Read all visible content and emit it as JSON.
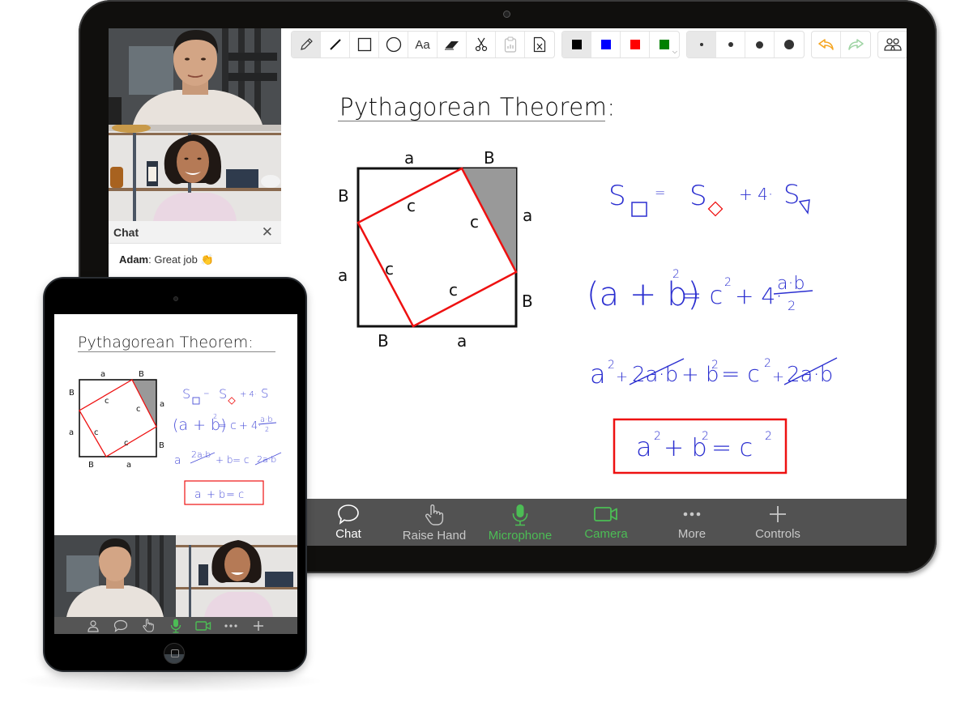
{
  "app": {
    "accent_green": "#4cbd55",
    "bar_color": "#525252"
  },
  "participants": [
    {
      "name": "Man in white t-shirt",
      "role": "video-feed"
    },
    {
      "name": "Woman in plaid shirt",
      "role": "video-feed"
    }
  ],
  "chat": {
    "title": "Chat",
    "close_icon": "close-icon",
    "messages": [
      {
        "sender": "Adam",
        "text": ": Great job ",
        "emoji": "👏"
      }
    ]
  },
  "toolbar": {
    "tools": [
      {
        "name": "pencil",
        "icon": "pencil-icon",
        "active": true
      },
      {
        "name": "line",
        "icon": "line-icon"
      },
      {
        "name": "rectangle",
        "icon": "rectangle-icon"
      },
      {
        "name": "circle",
        "icon": "circle-icon"
      },
      {
        "name": "text",
        "icon": "text-icon",
        "label": "Aa"
      },
      {
        "name": "eraser",
        "icon": "eraser-icon"
      },
      {
        "name": "cut",
        "icon": "scissors-icon"
      },
      {
        "name": "paste",
        "icon": "clipboard-icon",
        "disabled": true
      },
      {
        "name": "clear",
        "icon": "clear-file-icon"
      }
    ],
    "colors": [
      {
        "name": "black",
        "hex": "#000000",
        "active": true
      },
      {
        "name": "blue",
        "hex": "#0000ff"
      },
      {
        "name": "red",
        "hex": "#ff0000"
      },
      {
        "name": "green",
        "hex": "#008000",
        "has_dropdown": true
      }
    ],
    "sizes": [
      {
        "name": "size-1",
        "active": true
      },
      {
        "name": "size-2"
      },
      {
        "name": "size-3"
      },
      {
        "name": "size-4"
      }
    ],
    "history": [
      {
        "name": "undo",
        "icon": "undo-icon",
        "color": "#f5a623"
      },
      {
        "name": "redo",
        "icon": "redo-icon",
        "color": "#9fd4a4"
      }
    ],
    "participants_icon": "participants-icon"
  },
  "whiteboard": {
    "title": "Pythagorean Theorem:",
    "diagram": {
      "outer_labels": {
        "top": [
          "a",
          "B"
        ],
        "right": [
          "a",
          "B"
        ],
        "bottom": [
          "B",
          "a"
        ],
        "left": [
          "B",
          "a"
        ]
      },
      "inner_labels": [
        "c",
        "c",
        "c",
        "c"
      ]
    },
    "equations": [
      "S□ = S◇ + 4·S◺",
      "(a + b)² = c² + 4 · (a·b)/2",
      "a² + 2a·b + b² = c² + 2a·b",
      "a² + b² = c²"
    ],
    "eq_parts": {
      "s": "S",
      "eq": "=",
      "plus4": "+ 4·",
      "line2_lhs": "(a + b)",
      "sq": "2",
      "line2_rhs": "= c",
      "line2_tail": "+ 4·",
      "frac_num": "a·b",
      "frac_den": "2",
      "l3_a": "a",
      "l3_plus": "+",
      "l3_2ab": "2a·b",
      "l3_b": "+ b",
      "l3_eq": "= c",
      "l3_plus2": "+",
      "final_a": "a",
      "final_plus": "+ b",
      "final_eq": "= c"
    }
  },
  "meeting_bar": {
    "buttons": [
      {
        "label": "Chat",
        "icon": "chat-icon",
        "state": "white"
      },
      {
        "label": "Raise Hand",
        "icon": "raise-hand-icon",
        "state": "default"
      },
      {
        "label": "Microphone",
        "icon": "microphone-icon",
        "state": "green"
      },
      {
        "label": "Camera",
        "icon": "camera-icon",
        "state": "green"
      },
      {
        "label": "More",
        "icon": "more-icon",
        "state": "default"
      },
      {
        "label": "Controls",
        "icon": "plus-icon",
        "state": "default"
      }
    ]
  },
  "tablet": {
    "title": "Pythagorean Theorem:",
    "bar_icons": [
      "participants-icon",
      "chat-icon",
      "raise-hand-icon",
      "microphone-icon",
      "camera-icon",
      "more-icon",
      "plus-icon"
    ]
  }
}
